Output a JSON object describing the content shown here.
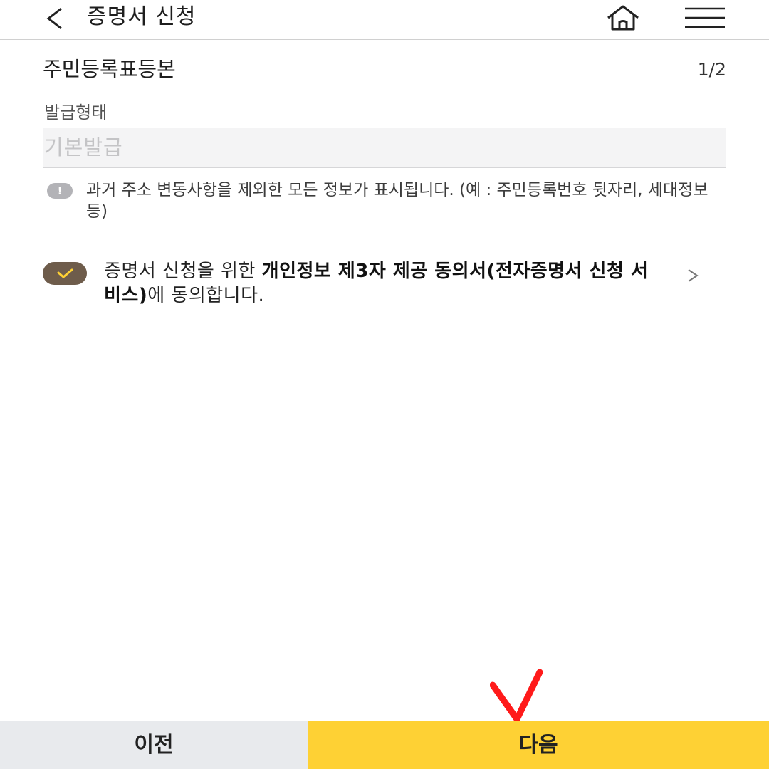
{
  "header": {
    "title": "증명서 신청",
    "back_icon": "chevron-left-icon",
    "home_icon": "home-icon",
    "menu_icon": "hamburger-menu-icon"
  },
  "document": {
    "title": "주민등록표등본",
    "page_indicator": "1/2"
  },
  "issue_type": {
    "label": "발급형태",
    "value": "기본발급"
  },
  "notice": {
    "icon": "exclamation-icon",
    "text": "과거 주소 변동사항을 제외한 모든 정보가 표시됩니다. (예 : 주민등록번호 뒷자리, 세대정보 등)"
  },
  "consent": {
    "checked": true,
    "text_prefix": "증명서 신청을 위한 ",
    "text_bold": "개인정보 제3자 제공 동의서(전자증명서 신청 서비스)",
    "text_suffix": "에 동의합니다.",
    "check_color": "#6e5c4b",
    "check_mark_color": "#fed134"
  },
  "footer": {
    "prev_label": "이전",
    "next_label": "다음",
    "prev_color": "#e8eaed",
    "next_color": "#fed134"
  },
  "annotation": {
    "mark": "red-check-mark",
    "color": "#ff1a1a"
  }
}
